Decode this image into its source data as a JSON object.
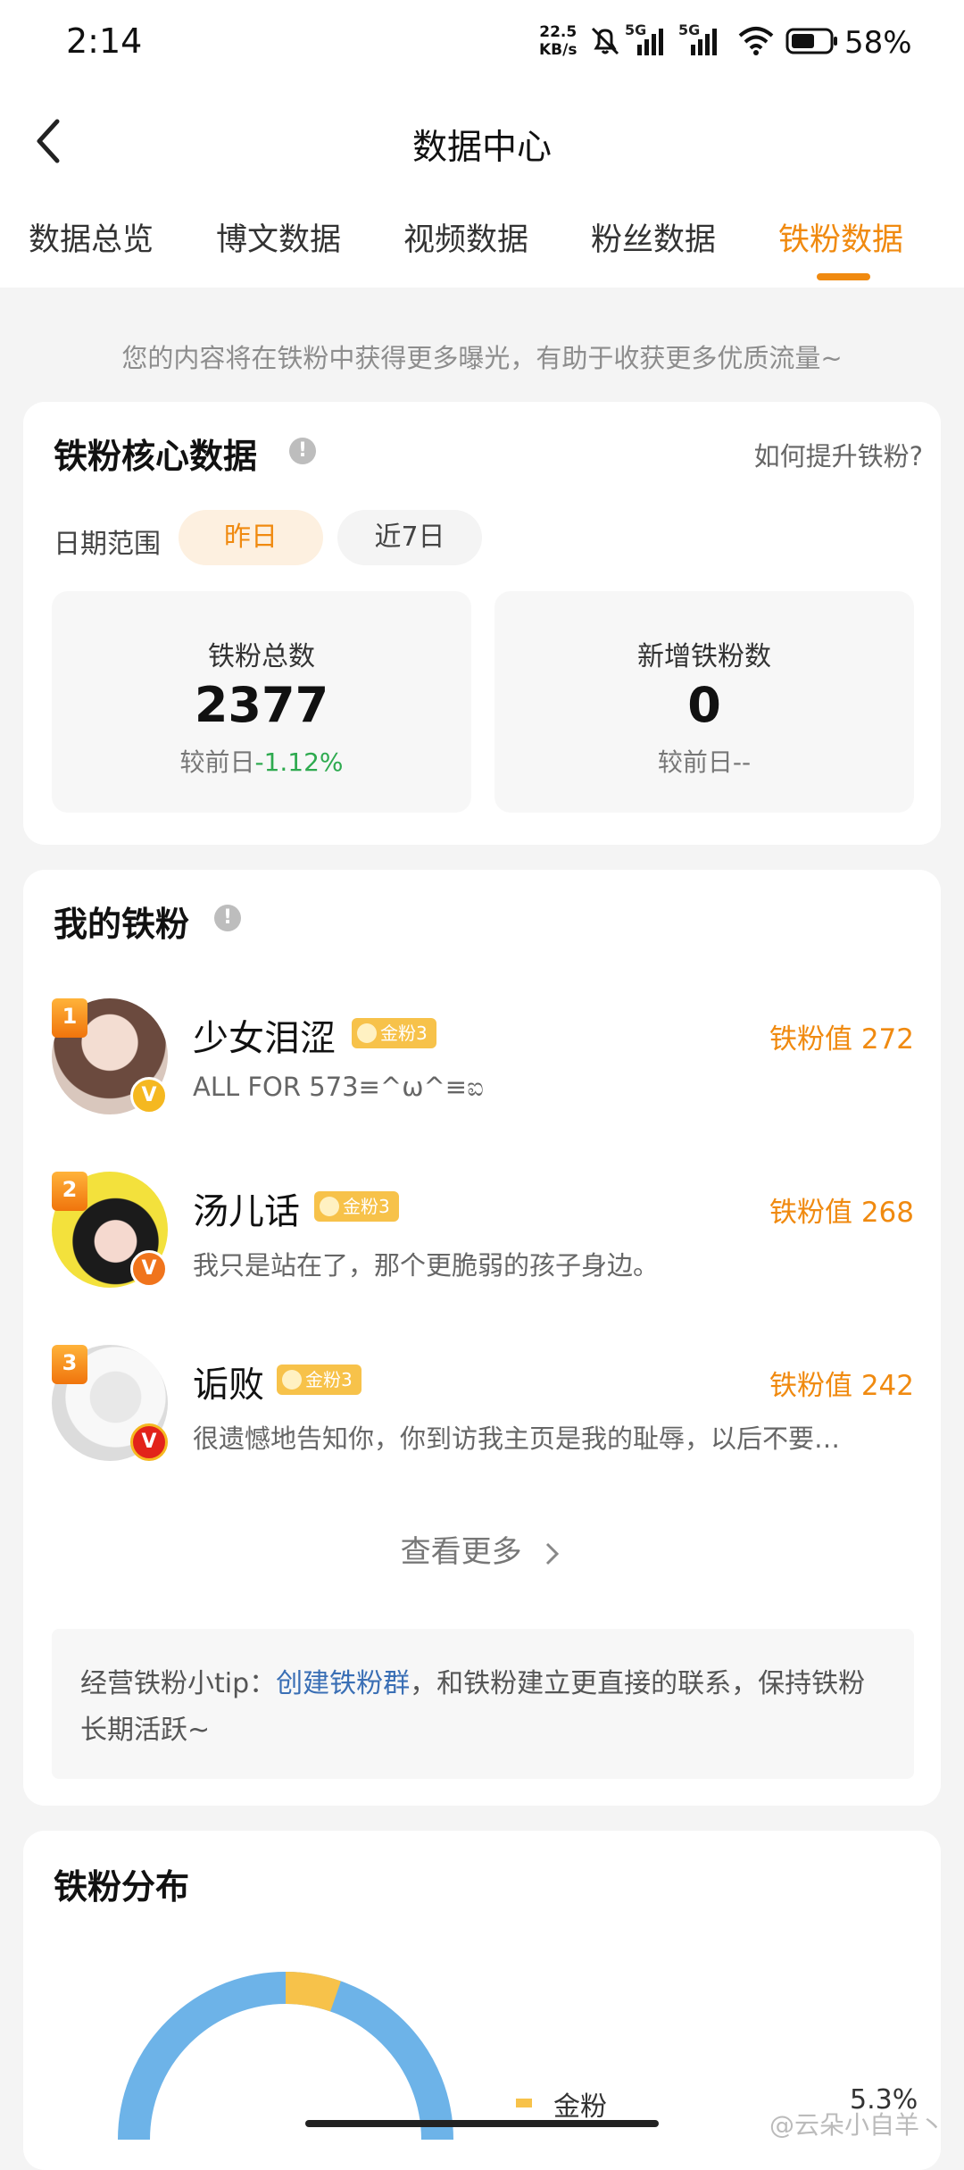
{
  "status_bar": {
    "time": "2:14",
    "net_speed_value": "22.5",
    "net_speed_unit": "KB/s",
    "signal1_label": "5G",
    "signal2_label": "5G",
    "battery": "58%"
  },
  "header": {
    "title": "数据中心"
  },
  "tabs": [
    {
      "label": "数据总览"
    },
    {
      "label": "博文数据"
    },
    {
      "label": "视频数据"
    },
    {
      "label": "粉丝数据"
    },
    {
      "label": "铁粉数据",
      "active": true
    }
  ],
  "top_tip": "您的内容将在铁粉中获得更多曝光，有助于收获更多优质流量~",
  "core": {
    "title": "铁粉核心数据",
    "help_link": "如何提升铁粉?",
    "date_label": "日期范围",
    "chips": [
      {
        "label": "昨日",
        "active": true
      },
      {
        "label": "近7日",
        "active": false
      }
    ],
    "stats": [
      {
        "label": "铁粉总数",
        "value": "2377",
        "compare_prefix": "较前日",
        "compare_value": "-1.12%"
      },
      {
        "label": "新增铁粉数",
        "value": "0",
        "compare_prefix": "较前日",
        "compare_value": "--"
      }
    ]
  },
  "my_fans": {
    "title": "我的铁粉",
    "fans": [
      {
        "rank": "1",
        "name": "少女泪涩",
        "badge": "金粉3",
        "value_label": "铁粉值 272",
        "signature": "ALL FOR 573≡^ω^≡ಐ",
        "verify": "V"
      },
      {
        "rank": "2",
        "name": "汤儿话",
        "badge": "金粉3",
        "value_label": "铁粉值 268",
        "signature": "我只是站在了，那个更脆弱的孩子身边。",
        "verify": "V"
      },
      {
        "rank": "3",
        "name": "诟败",
        "badge": "金粉3",
        "value_label": "铁粉值 242",
        "signature": "很遗憾地告知你，你到访我主页是我的耻辱，以后不要…",
        "verify": "V"
      }
    ],
    "more": "查看更多",
    "tip_prefix": "经营铁粉小tip：",
    "tip_link": "创建铁粉群",
    "tip_suffix": "，和铁粉建立更直接的联系，保持铁粉长期活跃~"
  },
  "distribution": {
    "title": "铁粉分布",
    "legend_label": "金粉",
    "legend_value": "5.3%"
  },
  "watermark": "@云朵小自羊丶",
  "colors": {
    "accent": "#f08a10",
    "green": "#2eaa4f",
    "link": "#3a6fb5",
    "gold_badge": "#f7c24a",
    "chart_blue": "#6db3e8"
  }
}
